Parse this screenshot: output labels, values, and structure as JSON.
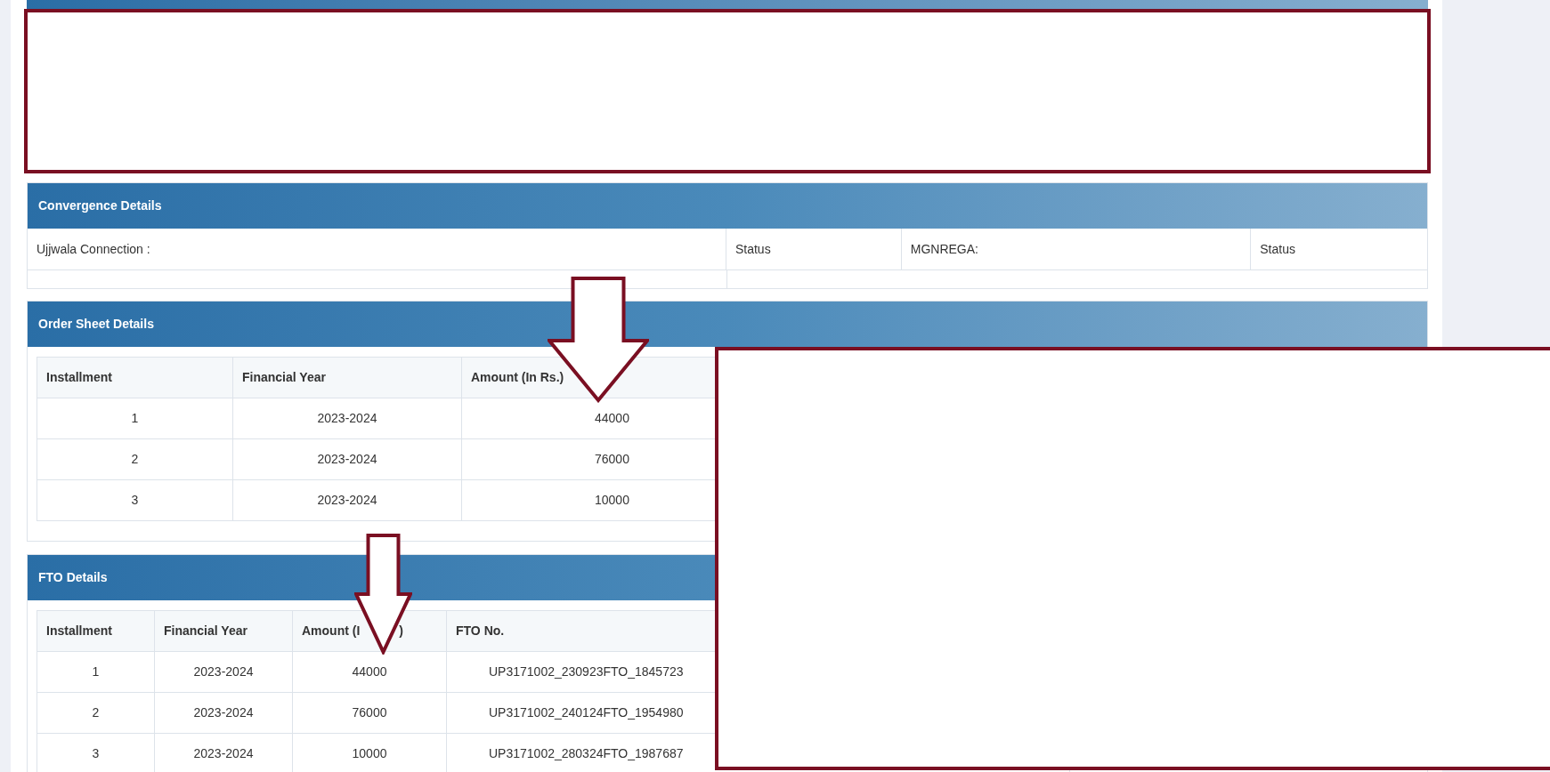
{
  "convergence": {
    "title": "Convergence Details",
    "cells": [
      {
        "text": "Ujjwala Connection :"
      },
      {
        "text": "Status"
      },
      {
        "text": "MGNREGA:"
      },
      {
        "text": "Status"
      }
    ]
  },
  "order_sheet": {
    "title": "Order Sheet Details",
    "columns": [
      "Installment",
      "Financial Year",
      "Amount (In Rs.)"
    ],
    "rows": [
      [
        "1",
        "2023-2024",
        "44000"
      ],
      [
        "2",
        "2023-2024",
        "76000"
      ],
      [
        "3",
        "2023-2024",
        "10000"
      ]
    ]
  },
  "fto": {
    "title": "FTO Details",
    "columns": [
      {
        "label": "Installment"
      },
      {
        "label": "Financial Year"
      },
      {
        "label": "Amount (I",
        "after_arrow": ")"
      },
      {
        "label": "FTO No."
      }
    ],
    "rows": [
      [
        "1",
        "2023-2024",
        "44000",
        "UP3171002_230923FTO_1845723"
      ],
      [
        "2",
        "2023-2024",
        "76000",
        "UP3171002_240124FTO_1954980"
      ],
      [
        "3",
        "2023-2024",
        "10000",
        "UP3171002_280324FTO_1987687"
      ]
    ]
  }
}
